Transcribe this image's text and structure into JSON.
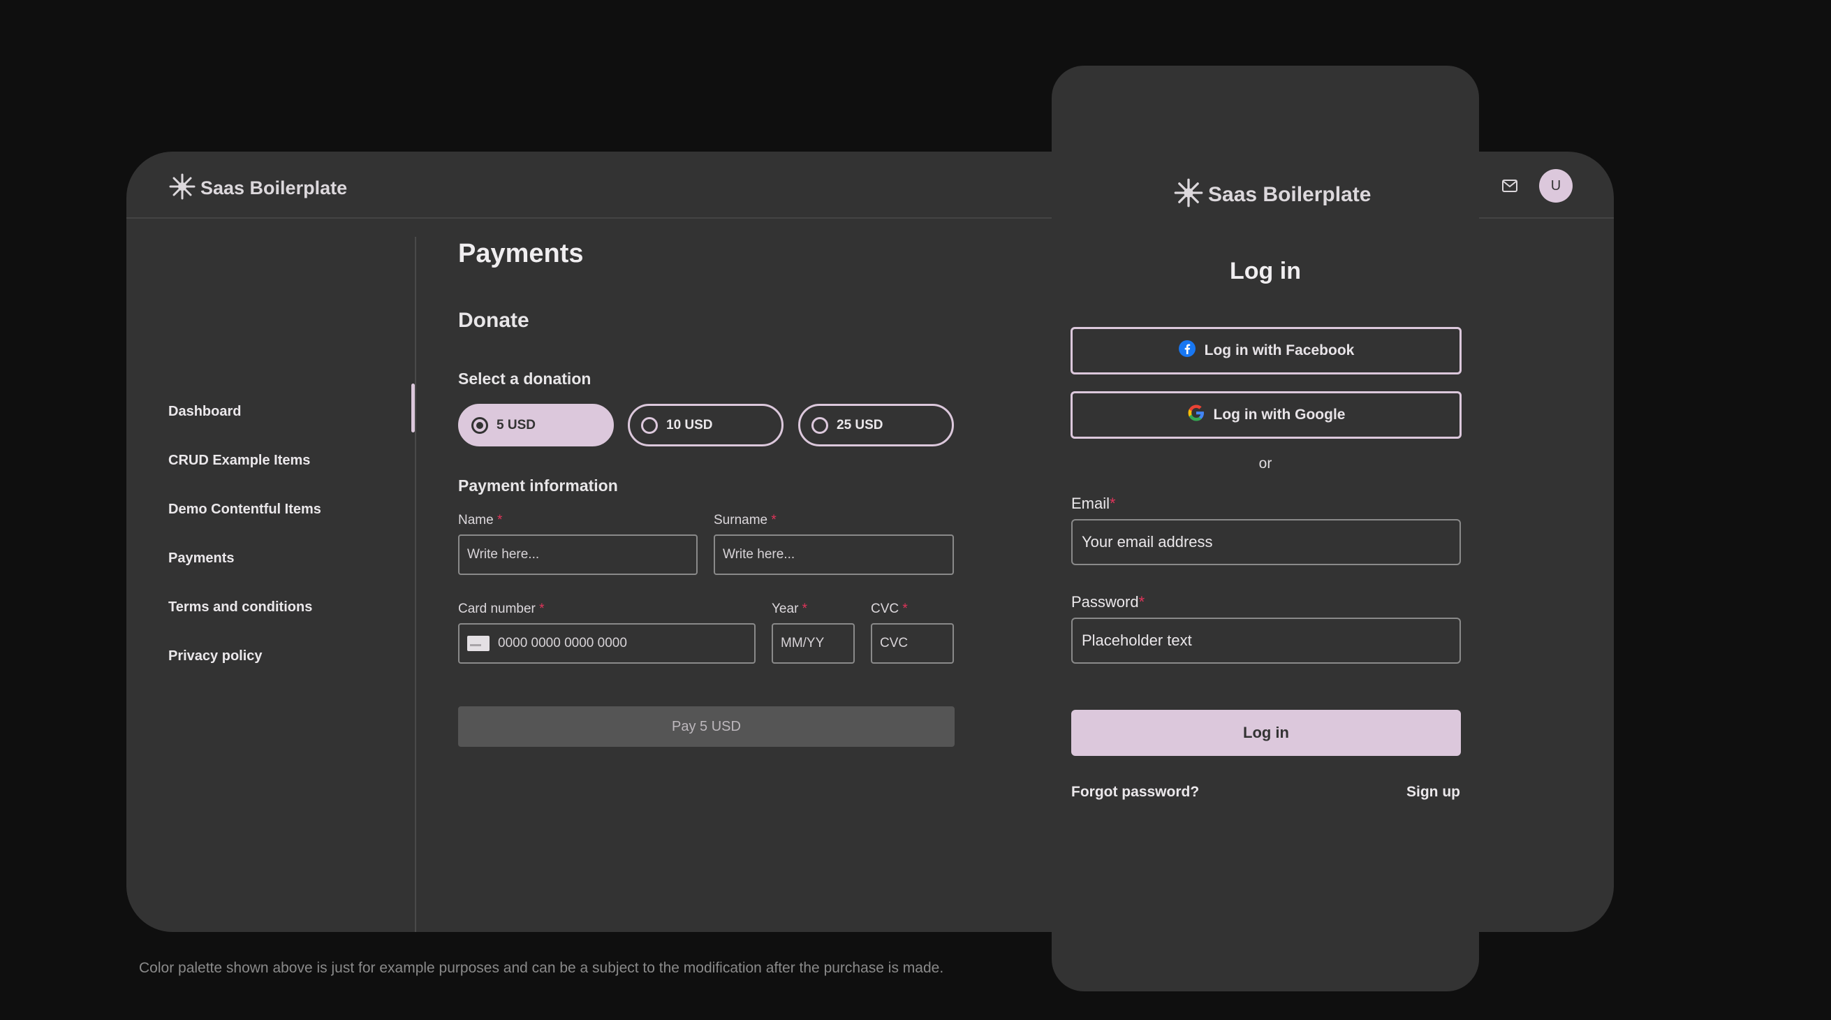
{
  "app": {
    "brand": "Saas Boilerplate",
    "avatar_initial": "U",
    "sidebar": {
      "items": [
        {
          "label": "Dashboard"
        },
        {
          "label": "CRUD Example Items"
        },
        {
          "label": "Demo Contentful Items"
        },
        {
          "label": "Payments"
        },
        {
          "label": "Terms and conditions"
        },
        {
          "label": "Privacy policy"
        }
      ],
      "active": "Payments"
    },
    "main": {
      "title": "Payments",
      "section": "Donate",
      "donation_label": "Select a donation",
      "donation_options": [
        {
          "label": "5 USD",
          "selected": true
        },
        {
          "label": "10 USD",
          "selected": false
        },
        {
          "label": "25 USD",
          "selected": false
        }
      ],
      "payment_info_label": "Payment information",
      "fields": {
        "name": {
          "label": "Name",
          "required": "*",
          "placeholder": "Write here..."
        },
        "surname": {
          "label": "Surname",
          "required": "*",
          "placeholder": "Write here..."
        },
        "card": {
          "label": "Card number",
          "required": "*",
          "placeholder": "0000 0000 0000 0000"
        },
        "year": {
          "label": "Year",
          "required": "*",
          "placeholder": "MM/YY"
        },
        "cvc": {
          "label": "CVC",
          "required": "*",
          "placeholder": "CVC"
        }
      },
      "pay_button": "Pay 5 USD"
    }
  },
  "footnote": "Color palette shown above is just for example purposes and can be a subject to the modification after the purchase is made.",
  "login": {
    "brand": "Saas Boilerplate",
    "title": "Log in",
    "facebook_button": "Log in with Facebook",
    "google_button": "Log in with Google",
    "or": "or",
    "email": {
      "label": "Email",
      "required": "*",
      "placeholder": "Your email address"
    },
    "password": {
      "label": "Password",
      "required": "*",
      "placeholder": "Placeholder text"
    },
    "submit": "Log in",
    "forgot": "Forgot password?",
    "signup": "Sign up"
  },
  "colors": {
    "accent": "#dcc8dc",
    "surface": "#333333",
    "background": "#0f0f0f",
    "required": "#e0345a"
  },
  "icons": [
    "brand-star-icon",
    "mail-icon",
    "radio-icon",
    "card-icon",
    "facebook-icon",
    "google-icon"
  ]
}
